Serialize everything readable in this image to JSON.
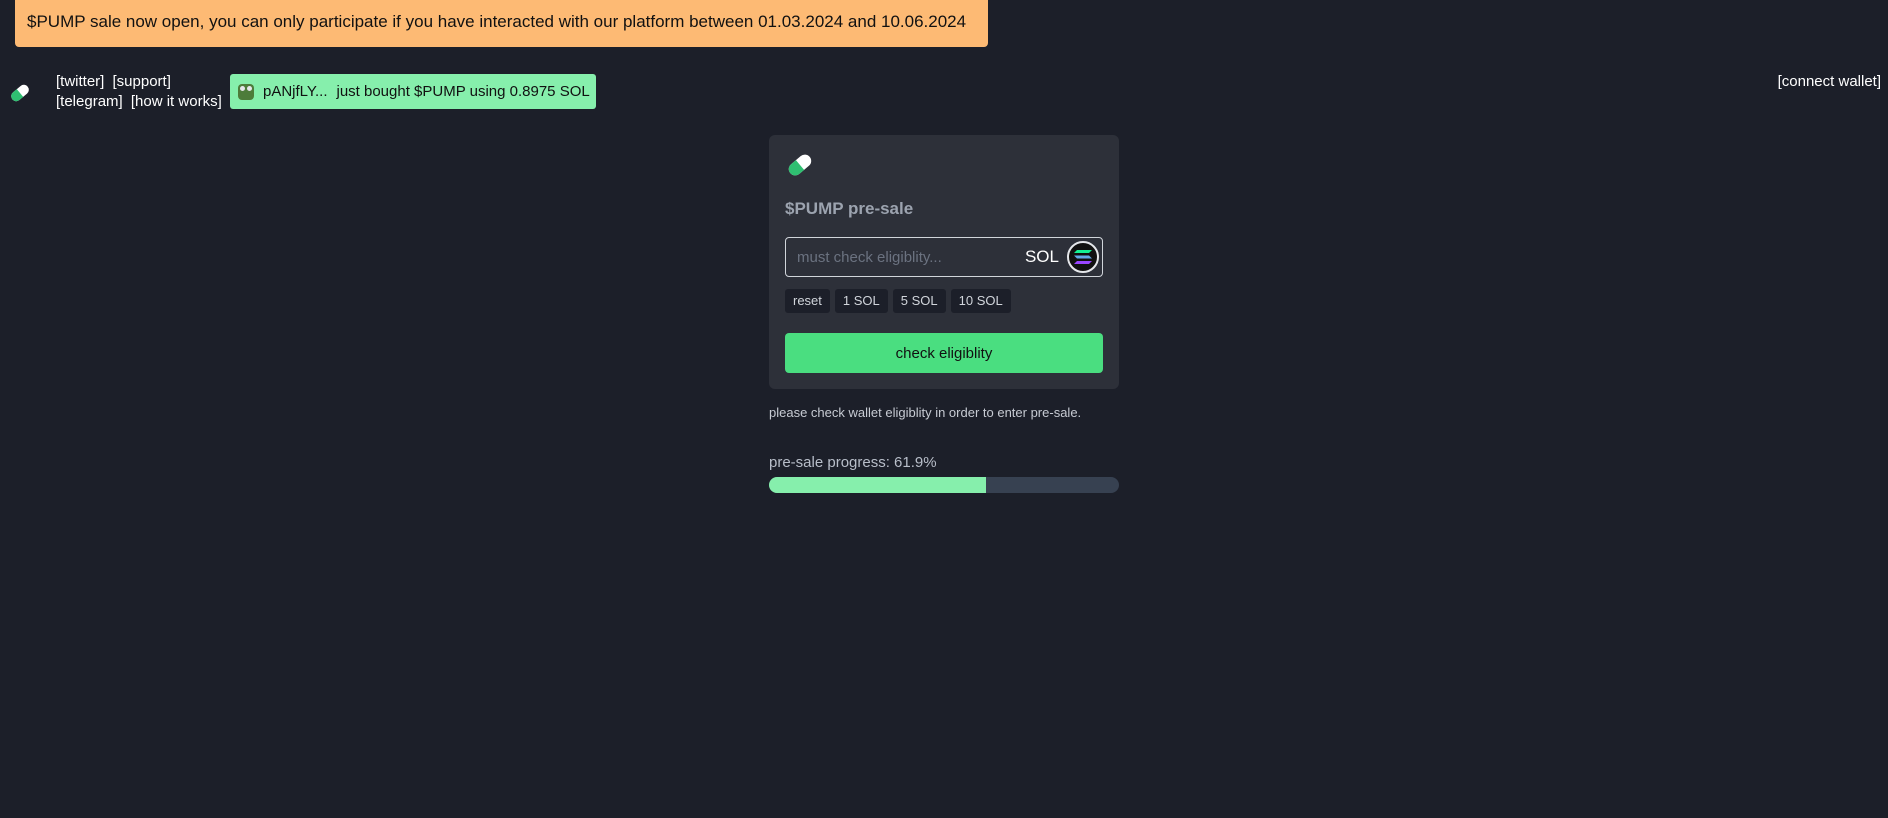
{
  "banner": {
    "text": "$PUMP sale now open, you can only participate if you have interacted with our platform between 01.03.2024 and 10.06.2024",
    "color": "#fdba74"
  },
  "header": {
    "logo_icon": "pill-icon",
    "links": {
      "twitter": "[twitter]",
      "support": "[support]",
      "telegram": "[telegram]",
      "how_it_works": "[how it works]"
    },
    "connect_wallet": "[connect wallet]"
  },
  "ticker": {
    "icon": "frog-avatar-icon",
    "address": "pANjfLY...",
    "message": "just bought $PUMP using 0.8975 SOL",
    "color": "#86efac"
  },
  "presale": {
    "logo_icon": "pill-icon",
    "title": "$PUMP pre-sale",
    "amount": {
      "placeholder": "must check eligiblity...",
      "value": "",
      "unit": "SOL",
      "unit_icon": "solana-icon"
    },
    "quick_buttons": [
      "reset",
      "1 SOL",
      "5 SOL",
      "10 SOL"
    ],
    "check_button": "check eligiblity",
    "accent": "#4ade80"
  },
  "note": "please check wallet eligiblity in order to enter pre-sale.",
  "progress": {
    "label": "pre-sale progress: 61.9%",
    "percent": 61.9,
    "fill_color": "#86efac"
  }
}
